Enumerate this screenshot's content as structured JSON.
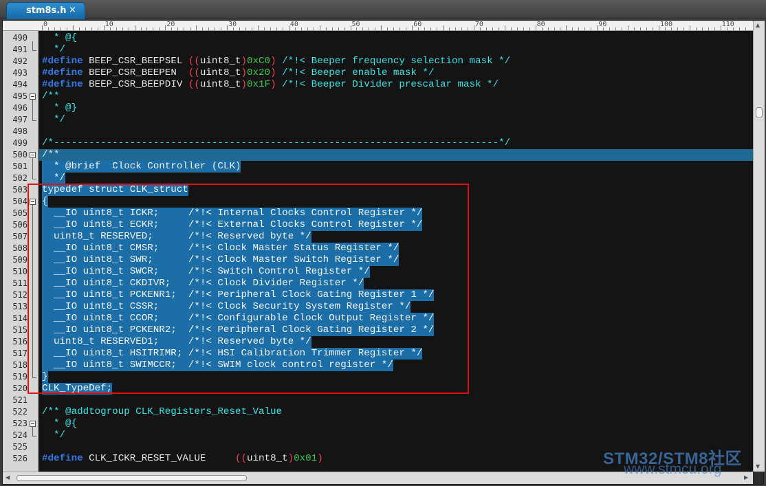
{
  "tab": {
    "title": "stm8s.h",
    "close": "×"
  },
  "ruler": {
    "labels": [
      "0",
      "10",
      "20",
      "30",
      "40",
      "50",
      "60",
      "70",
      "80",
      "90",
      "100",
      "110"
    ]
  },
  "lines": [
    {
      "n": "490",
      "tokens": [
        {
          "t": "  * @{",
          "c": "c"
        }
      ]
    },
    {
      "n": "491",
      "tokens": [
        {
          "t": "  */",
          "c": "c"
        }
      ]
    },
    {
      "n": "492",
      "tokens": [
        {
          "t": "#define",
          "c": "k"
        },
        {
          "t": " BEEP_CSR_BEEPSEL ",
          "c": "w"
        },
        {
          "t": "((",
          "c": "p"
        },
        {
          "t": "uint8_t",
          "c": "w"
        },
        {
          "t": ")",
          "c": "p"
        },
        {
          "t": "0xC0",
          "c": "h"
        },
        {
          "t": ")",
          "c": "p"
        },
        {
          "t": " /*!< Beeper frequency selection mask */",
          "c": "c"
        }
      ]
    },
    {
      "n": "493",
      "tokens": [
        {
          "t": "#define",
          "c": "k"
        },
        {
          "t": " BEEP_CSR_BEEPEN  ",
          "c": "w"
        },
        {
          "t": "((",
          "c": "p"
        },
        {
          "t": "uint8_t",
          "c": "w"
        },
        {
          "t": ")",
          "c": "p"
        },
        {
          "t": "0x20",
          "c": "h"
        },
        {
          "t": ")",
          "c": "p"
        },
        {
          "t": " /*!< Beeper enable mask */",
          "c": "c"
        }
      ]
    },
    {
      "n": "494",
      "tokens": [
        {
          "t": "#define",
          "c": "k"
        },
        {
          "t": " BEEP_CSR_BEEPDIV ",
          "c": "w"
        },
        {
          "t": "((",
          "c": "p"
        },
        {
          "t": "uint8_t",
          "c": "w"
        },
        {
          "t": ")",
          "c": "p"
        },
        {
          "t": "0x1F",
          "c": "h"
        },
        {
          "t": ")",
          "c": "p"
        },
        {
          "t": " /*!< Beeper Divider prescalar mask */",
          "c": "c"
        }
      ]
    },
    {
      "n": "495",
      "tokens": [
        {
          "t": "/**",
          "c": "c"
        }
      ]
    },
    {
      "n": "496",
      "tokens": [
        {
          "t": "  * @}",
          "c": "c"
        }
      ]
    },
    {
      "n": "497",
      "tokens": [
        {
          "t": "  */",
          "c": "c"
        }
      ]
    },
    {
      "n": "498",
      "tokens": []
    },
    {
      "n": "499",
      "tokens": [
        {
          "t": "/*----------------------------------------------------------------------------*/",
          "c": "c"
        }
      ]
    },
    {
      "n": "500",
      "tokens": [
        {
          "t": "/**",
          "c": "w"
        }
      ]
    },
    {
      "n": "501",
      "tokens": [
        {
          "t": "  * @brief  Clock Controller (CLK)",
          "c": "c"
        }
      ]
    },
    {
      "n": "502",
      "tokens": [
        {
          "t": "  */",
          "c": "c"
        }
      ]
    },
    {
      "n": "503",
      "tokens": [
        {
          "t": "typedef struct CLK_struct",
          "c": "c"
        }
      ]
    },
    {
      "n": "504",
      "tokens": [
        {
          "t": "{",
          "c": "c"
        }
      ]
    },
    {
      "n": "505",
      "tokens": [
        {
          "t": "  __IO uint8_t ICKR;     /*!< Internal Clocks Control Register */",
          "c": "c"
        }
      ]
    },
    {
      "n": "506",
      "tokens": [
        {
          "t": "  __IO uint8_t ECKR;     /*!< External Clocks Control Register */",
          "c": "c"
        }
      ]
    },
    {
      "n": "507",
      "tokens": [
        {
          "t": "  uint8_t RESERVED;      /*!< Reserved byte */",
          "c": "c"
        }
      ]
    },
    {
      "n": "508",
      "tokens": [
        {
          "t": "  __IO uint8_t CMSR;     /*!< Clock Master Status Register */",
          "c": "c"
        }
      ]
    },
    {
      "n": "509",
      "tokens": [
        {
          "t": "  __IO uint8_t SWR;      /*!< Clock Master Switch Register */",
          "c": "c"
        }
      ]
    },
    {
      "n": "510",
      "tokens": [
        {
          "t": "  __IO uint8_t SWCR;     /*!< Switch Control Register */",
          "c": "c"
        }
      ]
    },
    {
      "n": "511",
      "tokens": [
        {
          "t": "  __IO uint8_t CKDIVR;   /*!< Clock Divider Register */",
          "c": "c"
        }
      ]
    },
    {
      "n": "512",
      "tokens": [
        {
          "t": "  __IO uint8_t PCKENR1;  /*!< Peripheral Clock Gating Register 1 */",
          "c": "c"
        }
      ]
    },
    {
      "n": "513",
      "tokens": [
        {
          "t": "  __IO uint8_t CSSR;     /*!< Clock Security System Register */",
          "c": "c"
        }
      ]
    },
    {
      "n": "514",
      "tokens": [
        {
          "t": "  __IO uint8_t CCOR;     /*!< Configurable Clock Output Register */",
          "c": "c"
        }
      ]
    },
    {
      "n": "515",
      "tokens": [
        {
          "t": "  __IO uint8_t PCKENR2;  /*!< Peripheral Clock Gating Register 2 */",
          "c": "c"
        }
      ]
    },
    {
      "n": "516",
      "tokens": [
        {
          "t": "  uint8_t RESERVED1;     /*!< Reserved byte */",
          "c": "c"
        }
      ]
    },
    {
      "n": "517",
      "tokens": [
        {
          "t": "  __IO uint8_t HSITRIMR; /*!< HSI Calibration Trimmer Register */",
          "c": "c"
        }
      ]
    },
    {
      "n": "518",
      "tokens": [
        {
          "t": "  __IO uint8_t SWIMCCR;  /*!< SWIM clock control register */",
          "c": "c"
        }
      ]
    },
    {
      "n": "519",
      "tokens": [
        {
          "t": "}",
          "c": "c"
        }
      ]
    },
    {
      "n": "520",
      "tokens": [
        {
          "t": "CLK_TypeDef;",
          "c": "c"
        }
      ]
    },
    {
      "n": "521",
      "tokens": []
    },
    {
      "n": "522",
      "tokens": [
        {
          "t": "/** @addtogroup CLK_Registers_Reset_Value",
          "c": "c"
        }
      ]
    },
    {
      "n": "523",
      "tokens": [
        {
          "t": "  * @{",
          "c": "c"
        }
      ]
    },
    {
      "n": "524",
      "tokens": [
        {
          "t": "  */",
          "c": "c"
        }
      ]
    },
    {
      "n": "525",
      "tokens": []
    },
    {
      "n": "526",
      "tokens": [
        {
          "t": "#define",
          "c": "k"
        },
        {
          "t": " CLK_ICKR_RESET_VALUE     ",
          "c": "w"
        },
        {
          "t": "((",
          "c": "p"
        },
        {
          "t": "uint8_t",
          "c": "w"
        },
        {
          "t": ")",
          "c": "p"
        },
        {
          "t": "0x01",
          "c": "h"
        },
        {
          "t": ")",
          "c": "p"
        }
      ]
    }
  ],
  "selected_lines": [
    "500",
    "501",
    "502",
    "503",
    "504",
    "505",
    "506",
    "507",
    "508",
    "509",
    "510",
    "511",
    "512",
    "513",
    "514",
    "515",
    "516",
    "517",
    "518",
    "519",
    "520"
  ],
  "current_line": "500",
  "fold_lines": [
    "495",
    "500",
    "504",
    "523"
  ],
  "watermark": {
    "line1": "STM32/STM8社区",
    "line2": "www.stmcu.org"
  },
  "colors": {
    "keyword": "#2f7ae8",
    "comment": "#33e6e6",
    "hex": "#36c94a",
    "paren": "#ff3a5a",
    "selection": "#1b6ea8",
    "highlight_box": "#e01010"
  }
}
